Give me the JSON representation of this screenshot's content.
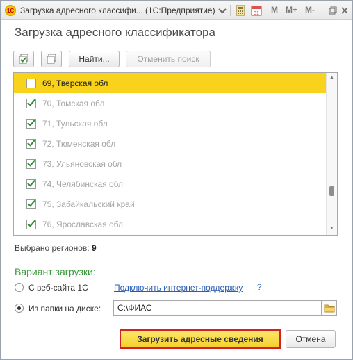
{
  "window": {
    "title": "Загрузка адресного классифи...  (1С:Предприятие)",
    "app_icon_text": "1С",
    "titlebar_buttons": {
      "memory": "M",
      "memory_plus": "M+",
      "memory_minus": "M-"
    }
  },
  "heading": "Загрузка адресного классификатора",
  "toolbar": {
    "find_label": "Найти...",
    "cancel_search_label": "Отменить поиск"
  },
  "regions": [
    {
      "label": "69, Тверская обл",
      "checked": false,
      "selected": true
    },
    {
      "label": "70, Томская обл",
      "checked": true,
      "selected": false
    },
    {
      "label": "71, Тульская обл",
      "checked": true,
      "selected": false
    },
    {
      "label": "72, Тюменская обл",
      "checked": true,
      "selected": false
    },
    {
      "label": "73, Ульяновская обл",
      "checked": true,
      "selected": false
    },
    {
      "label": "74, Челябинская обл",
      "checked": true,
      "selected": false
    },
    {
      "label": "75, Забайкальский край",
      "checked": true,
      "selected": false
    },
    {
      "label": "76, Ярославская обл",
      "checked": true,
      "selected": false
    }
  ],
  "selected_count": {
    "label": "Выбрано регионов:",
    "value": "9"
  },
  "load_variant": {
    "title": "Вариант загрузки:",
    "option_web": "С веб-сайта 1С",
    "connect_link": "Подключить интернет-поддержку",
    "help_mark": "?",
    "option_folder": "Из папки на диске:",
    "folder_path": "C:\\ФИАС",
    "selected_option": "folder"
  },
  "buttons": {
    "load": "Загрузить адресные сведения",
    "cancel": "Отмена"
  },
  "colors": {
    "selection": "#f9d21c",
    "accent_green": "#3c9a3c",
    "link_blue": "#2a5db0",
    "primary_border": "#d32020"
  }
}
